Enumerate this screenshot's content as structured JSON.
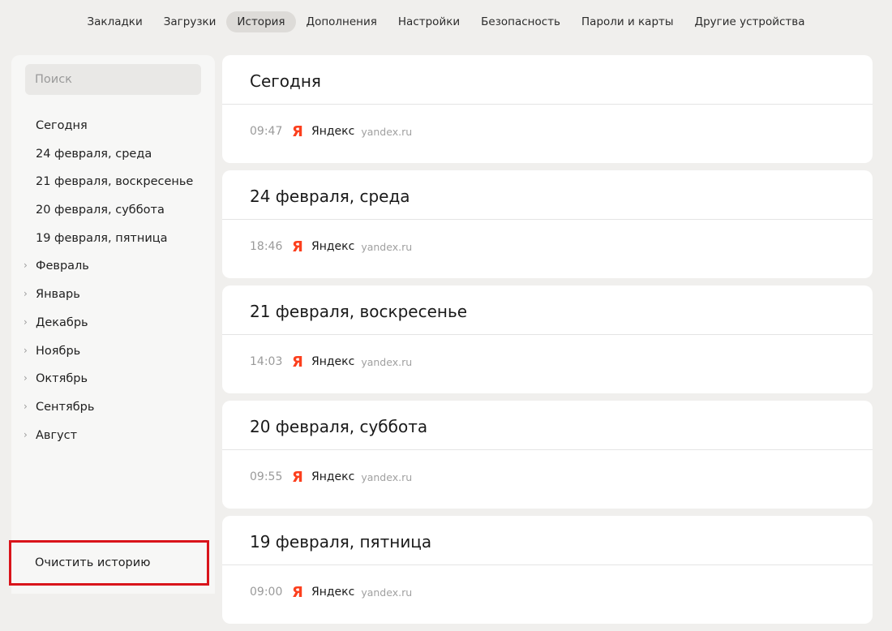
{
  "nav": {
    "tabs": [
      {
        "label": "Закладки"
      },
      {
        "label": "Загрузки"
      },
      {
        "label": "История"
      },
      {
        "label": "Дополнения"
      },
      {
        "label": "Настройки"
      },
      {
        "label": "Безопасность"
      },
      {
        "label": "Пароли и карты"
      },
      {
        "label": "Другие устройства"
      }
    ],
    "active_tab": "История"
  },
  "sidebar": {
    "search_placeholder": "Поиск",
    "items": [
      {
        "label": "Сегодня"
      },
      {
        "label": "24 февраля, среда"
      },
      {
        "label": "21 февраля, воскресенье"
      },
      {
        "label": "20 февраля, суббота"
      },
      {
        "label": "19 февраля, пятница"
      },
      {
        "label": "Февраль",
        "expandable": true
      },
      {
        "label": "Январь",
        "expandable": true
      },
      {
        "label": "Декабрь",
        "expandable": true
      },
      {
        "label": "Ноябрь",
        "expandable": true
      },
      {
        "label": "Октябрь",
        "expandable": true
      },
      {
        "label": "Сентябрь",
        "expandable": true
      },
      {
        "label": "Август",
        "expandable": true
      }
    ],
    "clear_label": "Очистить историю"
  },
  "history": {
    "days": [
      {
        "title": "Сегодня",
        "entries": [
          {
            "time": "09:47",
            "icon": "yandex-icon",
            "icon_glyph": "Я",
            "site": "Яндекс",
            "url": "yandex.ru"
          }
        ]
      },
      {
        "title": "24 февраля, среда",
        "entries": [
          {
            "time": "18:46",
            "icon": "yandex-icon",
            "icon_glyph": "Я",
            "site": "Яндекс",
            "url": "yandex.ru"
          }
        ]
      },
      {
        "title": "21 февраля, воскресенье",
        "entries": [
          {
            "time": "14:03",
            "icon": "yandex-icon",
            "icon_glyph": "Я",
            "site": "Яндекс",
            "url": "yandex.ru"
          }
        ]
      },
      {
        "title": "20 февраля, суббота",
        "entries": [
          {
            "time": "09:55",
            "icon": "yandex-icon",
            "icon_glyph": "Я",
            "site": "Яндекс",
            "url": "yandex.ru"
          }
        ]
      },
      {
        "title": "19 февраля, пятница",
        "entries": [
          {
            "time": "09:00",
            "icon": "yandex-icon",
            "icon_glyph": "Я",
            "site": "Яндекс",
            "url": "yandex.ru"
          }
        ]
      }
    ]
  },
  "colors": {
    "background": "#f0efed",
    "accent_brand": "#fc3f1d",
    "highlight_border": "#d9141b"
  }
}
